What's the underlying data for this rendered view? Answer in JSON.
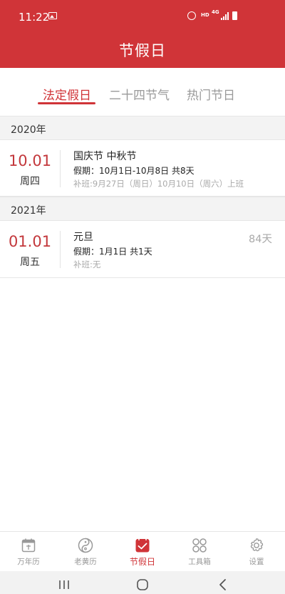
{
  "status_bar": {
    "time": "11:22",
    "hd": "HD",
    "network": "4G"
  },
  "header": {
    "title": "节假日"
  },
  "tabs": [
    {
      "label": "法定假日",
      "active": true
    },
    {
      "label": "二十四节气",
      "active": false
    },
    {
      "label": "热门节日",
      "active": false
    }
  ],
  "groups": [
    {
      "year": "2020年",
      "holidays": [
        {
          "date": "10.01",
          "weekday": "周四",
          "name": "国庆节 中秋节",
          "vacation": "假期：10月1日-10月8日 共8天",
          "workdays": "补班:9月27日（周日）10月10日（周六）上班",
          "countdown": ""
        }
      ]
    },
    {
      "year": "2021年",
      "holidays": [
        {
          "date": "01.01",
          "weekday": "周五",
          "name": "元旦",
          "vacation": "假期：1月1日 共1天",
          "workdays": "补班:无",
          "countdown": "84天"
        }
      ]
    }
  ],
  "bottom_nav": [
    {
      "label": "万年历",
      "icon": "calendar-icon",
      "active": false
    },
    {
      "label": "老黄历",
      "icon": "yin-yang-icon",
      "active": false
    },
    {
      "label": "节假日",
      "icon": "holiday-check-icon",
      "active": true
    },
    {
      "label": "工具箱",
      "icon": "toolbox-grid-icon",
      "active": false
    },
    {
      "label": "设置",
      "icon": "gear-icon",
      "active": false
    }
  ],
  "colors": {
    "brand": "#d03438",
    "date_red": "#c3383c",
    "muted": "#aaaaaa"
  }
}
